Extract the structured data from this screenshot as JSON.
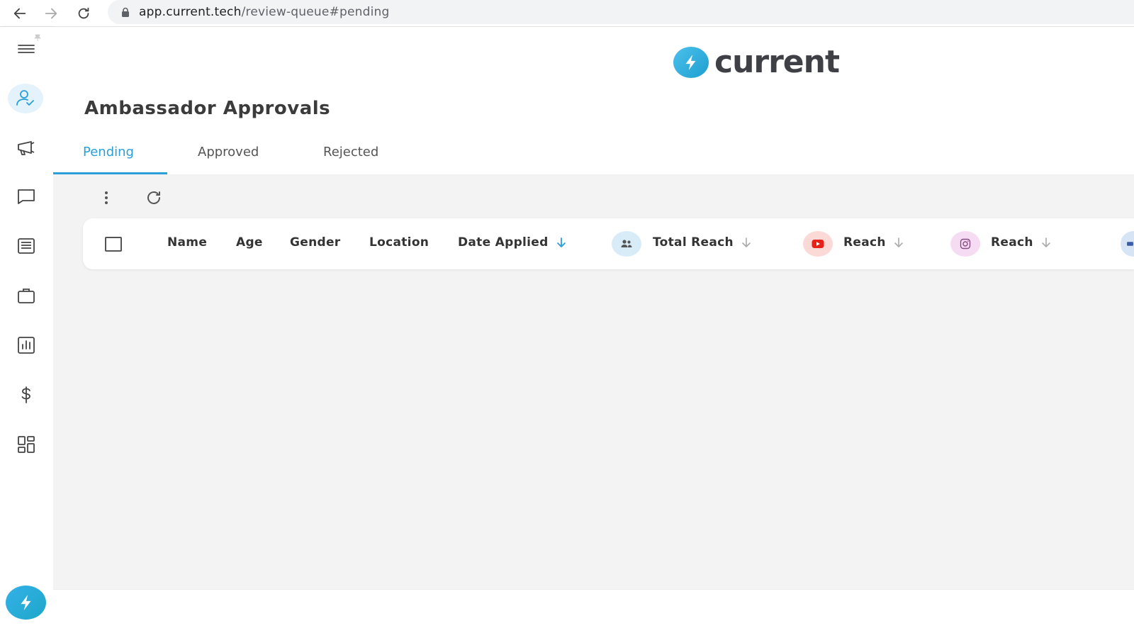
{
  "browser": {
    "url_host": "app.current.tech",
    "url_path": "/review-queue#pending"
  },
  "sidebar": {
    "items": [
      {
        "icon": "menu-icon"
      },
      {
        "icon": "user-check-icon",
        "active": true
      },
      {
        "icon": "megaphone-icon"
      },
      {
        "icon": "chat-icon"
      },
      {
        "icon": "document-icon"
      },
      {
        "icon": "briefcase-icon"
      },
      {
        "icon": "bar-chart-icon"
      },
      {
        "icon": "dollar-icon"
      },
      {
        "icon": "dashboard-icon"
      }
    ],
    "bottom_icon": "bolt-icon"
  },
  "logo": {
    "text": "current"
  },
  "page": {
    "title": "Ambassador Approvals"
  },
  "tabs": [
    {
      "label": "Pending",
      "active": true
    },
    {
      "label": "Approved",
      "active": false
    },
    {
      "label": "Rejected",
      "active": false
    }
  ],
  "table": {
    "columns": [
      {
        "label": "Name"
      },
      {
        "label": "Age"
      },
      {
        "label": "Gender"
      },
      {
        "label": "Location"
      },
      {
        "label": "Date Applied",
        "sorted": true
      },
      {
        "label": "Total Reach",
        "network": "people-icon"
      },
      {
        "label": "Reach",
        "network": "youtube-icon"
      },
      {
        "label": "Reach",
        "network": "instagram-icon"
      }
    ]
  },
  "colors": {
    "accent": "#2a9fd8",
    "sidebar_active_bg": "#e3f2fb",
    "youtube": "#e62117",
    "instagram": "#c13584"
  }
}
